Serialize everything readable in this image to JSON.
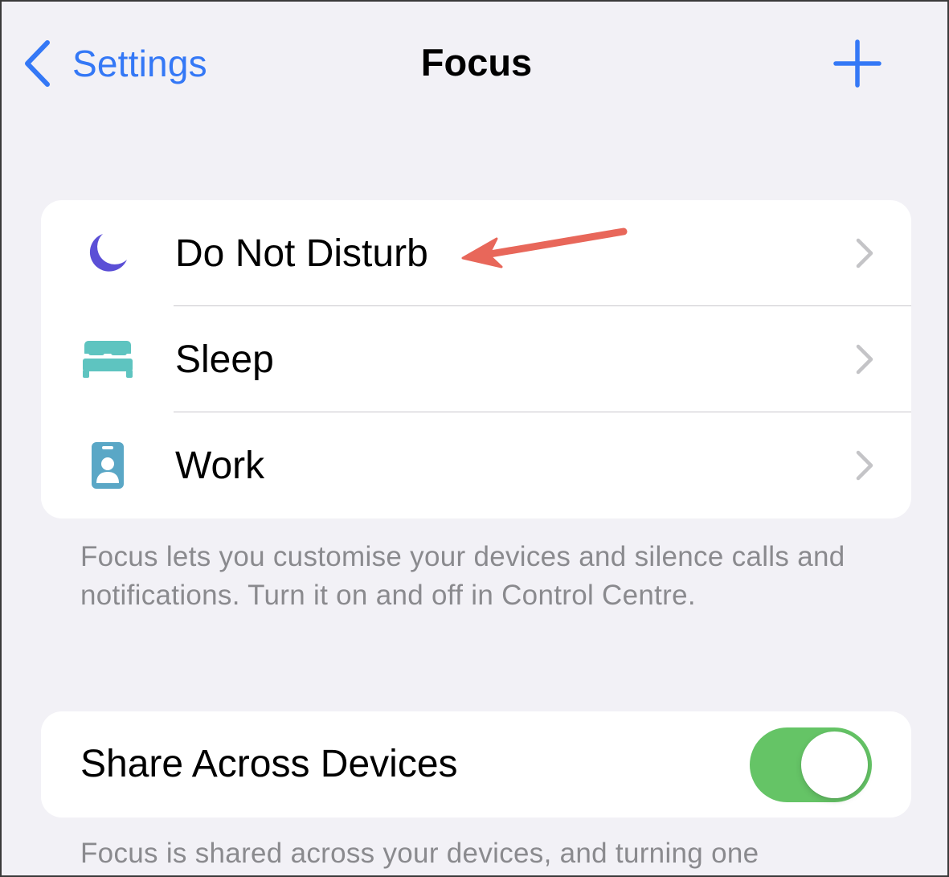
{
  "colors": {
    "accent": "#3478f6",
    "toggle_on": "#65c466",
    "moon_icon": "#5b4fd6",
    "sleep_icon": "#5ec4c0",
    "work_icon": "#5aa7c6",
    "annotation_arrow": "#e8675a",
    "chevron": "#c4c4c7"
  },
  "nav": {
    "back_label": "Settings",
    "title": "Focus",
    "add_icon": "plus-icon",
    "back_icon": "chevron-left-icon"
  },
  "focus_modes": [
    {
      "label": "Do Not Disturb",
      "icon": "moon-icon"
    },
    {
      "label": "Sleep",
      "icon": "bed-icon"
    },
    {
      "label": "Work",
      "icon": "id-badge-icon"
    }
  ],
  "focus_footer": "Focus lets you customise your devices and silence calls and notifications. Turn it on and off in Control Centre.",
  "share": {
    "label": "Share Across Devices",
    "enabled": true
  },
  "share_footer": "Focus is shared across your devices, and turning one"
}
